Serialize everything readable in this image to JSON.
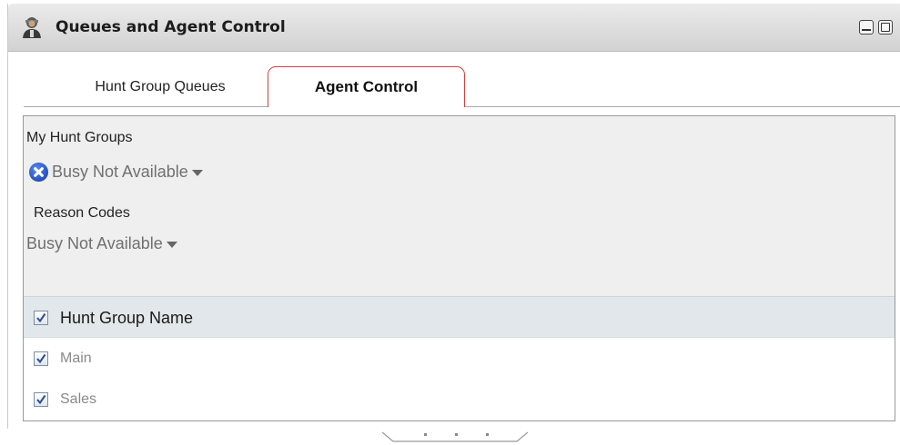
{
  "window": {
    "title": "Queues and Agent Control",
    "icon": "agent-icon"
  },
  "tabs": [
    {
      "label": "Hunt Group Queues",
      "active": false
    },
    {
      "label": "Agent Control",
      "active": true
    }
  ],
  "agent_control": {
    "my_hunt_groups_label": "My Hunt Groups",
    "status_value": "Busy Not Available",
    "reason_codes_label": "Reason Codes",
    "reason_value": "Busy Not Available"
  },
  "hunt_groups": {
    "header": "Hunt Group Name",
    "header_checked": true,
    "rows": [
      {
        "name": "Main",
        "checked": true
      },
      {
        "name": "Sales",
        "checked": true
      }
    ]
  },
  "colors": {
    "active_tab_border": "#d4423d",
    "busy_icon": "#2b5fd0",
    "header_row_bg": "#e1e7ea"
  }
}
